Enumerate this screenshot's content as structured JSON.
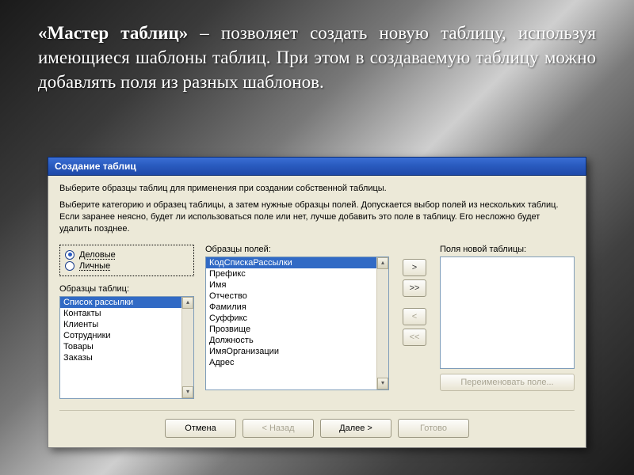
{
  "slide": {
    "heading_bold": "«Мастер таблиц»",
    "heading_rest": " – позволяет создать новую таблицу, используя имеющиеся шаблоны таблиц. При этом в создаваемую таблицу можно добавлять поля из разных шаблонов."
  },
  "dialog": {
    "title": "Создание таблиц",
    "intro1": "Выберите образцы таблиц для применения при создании собственной таблицы.",
    "intro2": "Выберите категорию и образец таблицы, а затем нужные образцы полей. Допускается выбор полей из нескольких таблиц. Если заранее неясно, будет ли использоваться поле или нет, лучше добавить это поле в таблицу. Его несложно будет удалить позднее.",
    "radios": {
      "business": "Деловые",
      "personal": "Личные"
    },
    "labels": {
      "sample_tables": "Образцы таблиц:",
      "sample_fields": "Образцы полей:",
      "new_fields": "Поля новой таблицы:"
    },
    "sample_tables": [
      "Список рассылки",
      "Контакты",
      "Клиенты",
      "Сотрудники",
      "Товары",
      "Заказы"
    ],
    "sample_tables_selected": 0,
    "sample_fields": [
      "КодСпискаРассылки",
      "Префикс",
      "Имя",
      "Отчество",
      "Фамилия",
      "Суффикс",
      "Прозвище",
      "Должность",
      "ИмяОрганизации",
      "Адрес"
    ],
    "sample_fields_selected": 0,
    "move_buttons": {
      "add": " >",
      "add_all": ">>",
      "remove": "<",
      "remove_all": "<<"
    },
    "rename": "Переименовать поле...",
    "footer": {
      "cancel": "Отмена",
      "back": "< Назад",
      "next": "Далее >",
      "finish": "Готово"
    }
  }
}
